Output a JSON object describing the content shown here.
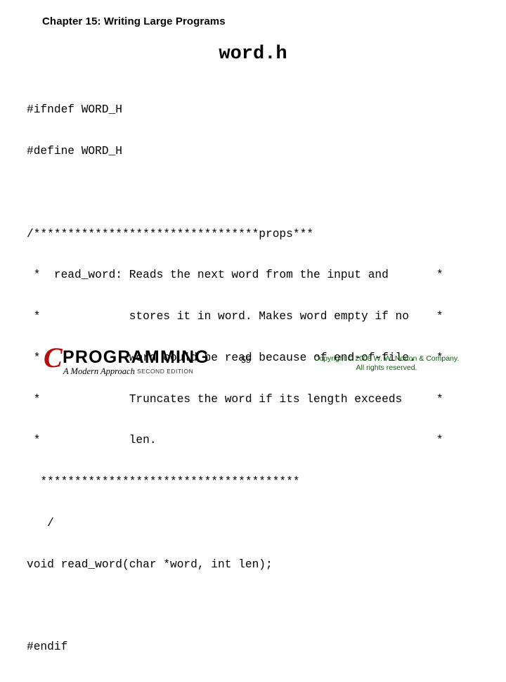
{
  "slide": {
    "chapter_title": "Chapter 15: Writing Large Programs",
    "file_title": "word.h",
    "code_lines": [
      "#ifndef WORD_H",
      "#define WORD_H",
      "",
      "/*********************************props***",
      " *  read_word: Reads the next word from the input and       *",
      " *             stores it in word. Makes word empty if no    *",
      " *             word could be read because of end-of-file.   *",
      " *             Truncates the word if its length exceeds     *",
      " *             len.                                         *",
      "  **************************************",
      "   /",
      "void read_word(char *word, int len);",
      "",
      "#endif"
    ],
    "footer": {
      "logo_c": "C",
      "logo_programming": "PROGRAMMING",
      "logo_subtitle": "A Modern Approach",
      "logo_edition": "SECOND EDITION",
      "page_number": "55",
      "copyright_line1": "Copyright © 2008 W. W. Norton & Company.",
      "copyright_line2": "All rights reserved.",
      "copyright_color": "#0a5c0a",
      "logo_accent_color": "#b21010"
    }
  }
}
